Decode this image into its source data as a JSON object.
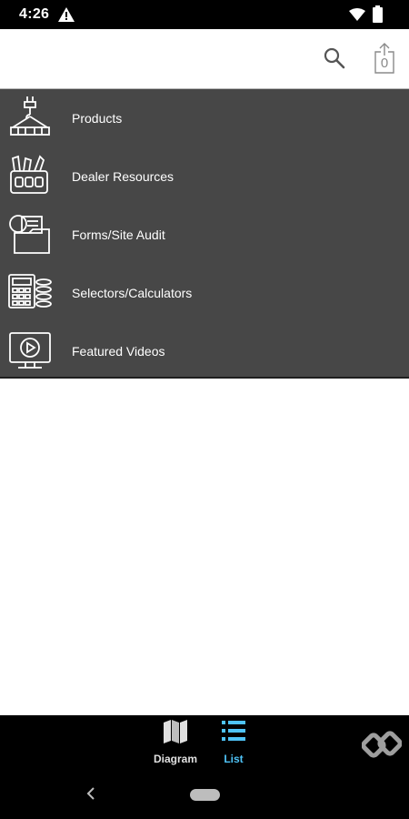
{
  "status_bar": {
    "time": "4:26"
  },
  "toolbar": {
    "search_icon": "search-icon",
    "export_icon": "export-icon",
    "export_count": "0"
  },
  "menu": {
    "items": [
      {
        "label": "Products",
        "icon": "crane-hook-icon"
      },
      {
        "label": "Dealer Resources",
        "icon": "tool-box-icon"
      },
      {
        "label": "Forms/Site Audit",
        "icon": "forms-folder-icon"
      },
      {
        "label": "Selectors/Calculators",
        "icon": "calculator-icon"
      },
      {
        "label": "Featured Videos",
        "icon": "video-monitor-icon"
      }
    ]
  },
  "bottom_nav": {
    "tabs": [
      {
        "label": "Diagram",
        "icon": "map-icon",
        "active": false
      },
      {
        "label": "List",
        "icon": "list-icon",
        "active": true
      }
    ],
    "brand_icon": "chain-link-logo"
  },
  "colors": {
    "menu_background": "#474747",
    "active_tab": "#4fc3f7",
    "inactive_tab": "#e0e0e0",
    "status_bar": "#000000"
  }
}
